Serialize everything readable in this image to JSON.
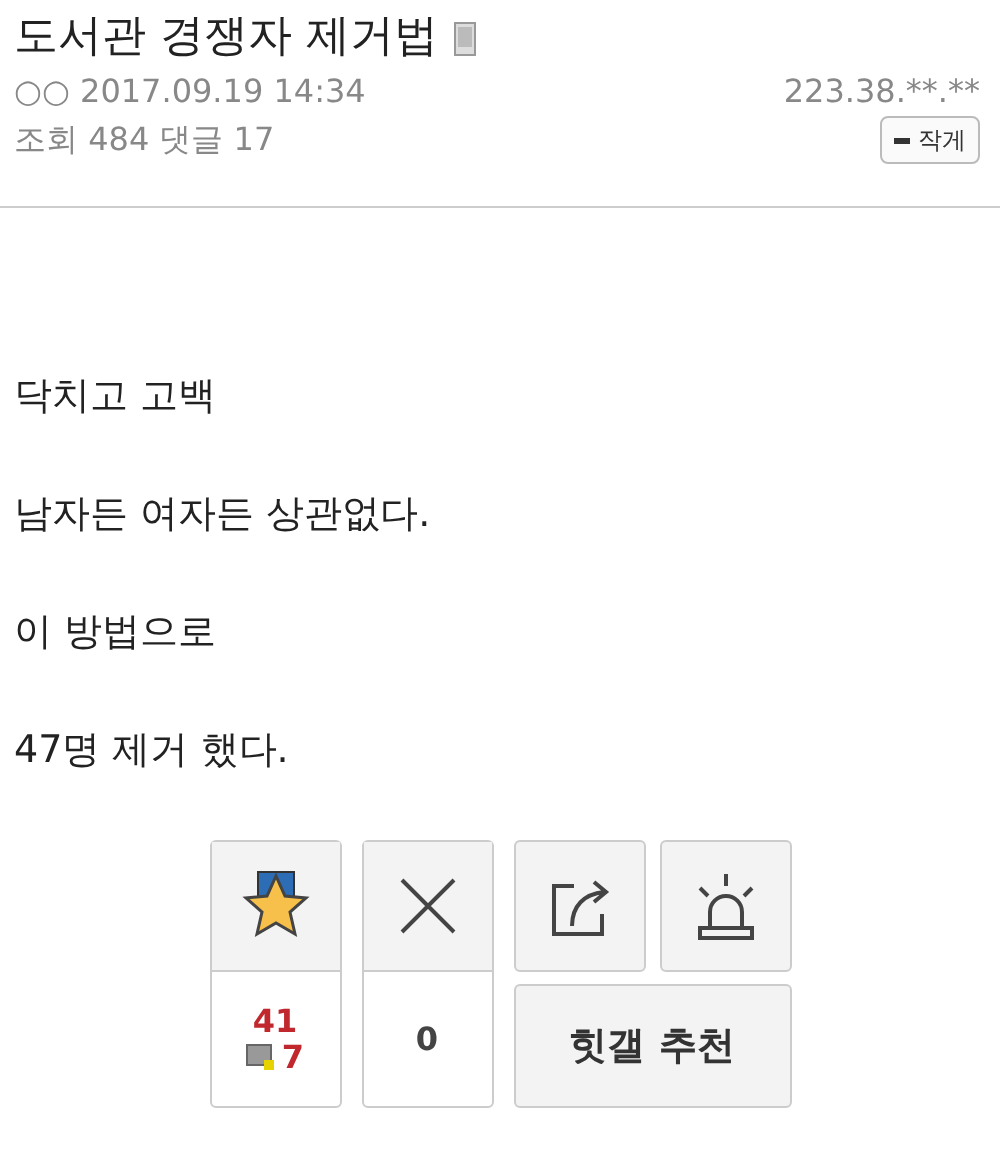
{
  "post": {
    "title": "도서관 경쟁자 제거법",
    "author": "○○",
    "date": "2017.09.19 14:34",
    "ip": "223.38.**.**",
    "views_label": "조회",
    "views": "484",
    "comments_label": "댓글",
    "comments": "17",
    "font_button": "작게"
  },
  "body": [
    "닥치고 고백",
    "남자든 여자든 상관없다.",
    "이 방법으로",
    "47명 제거 했다."
  ],
  "actions": {
    "likes": "41",
    "mobile_likes": "7",
    "dislikes": "0",
    "recommend": "힛갤 추천"
  }
}
